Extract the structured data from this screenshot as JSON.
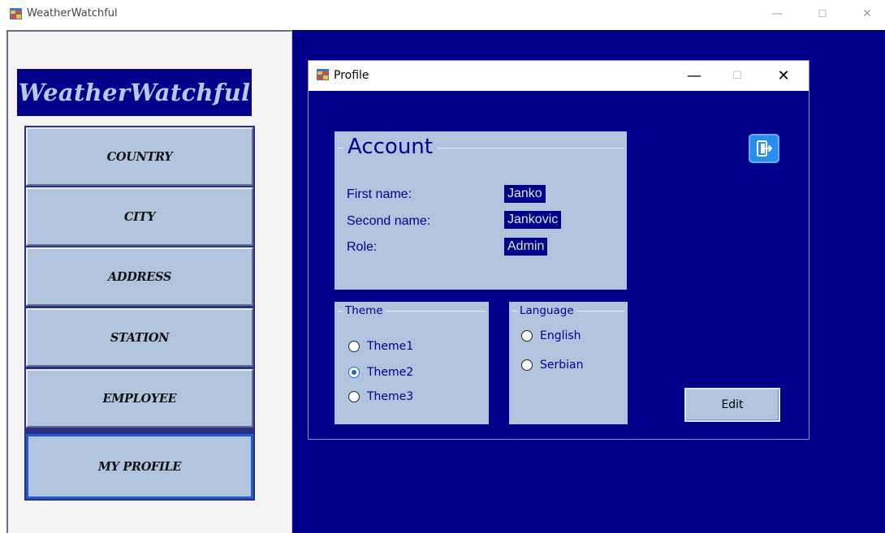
{
  "window": {
    "title": "WeatherWatchful",
    "minimize": "—",
    "maximize": "☐",
    "close": "✕"
  },
  "sidebar": {
    "logo": "WeatherWatchful",
    "items": [
      {
        "label": "COUNTRY"
      },
      {
        "label": "CITY"
      },
      {
        "label": "ADDRESS"
      },
      {
        "label": "STATION"
      },
      {
        "label": "EMPLOYEE"
      },
      {
        "label": "MY PROFILE",
        "active": true
      }
    ]
  },
  "profile": {
    "title": "Profile",
    "minimize": "—",
    "maximize": "☐",
    "close": "✕",
    "account": {
      "title": "Account",
      "first_name_label": "First name:",
      "first_name_value": "Janko",
      "second_name_label": "Second name:",
      "second_name_value": "Jankovic",
      "role_label": "Role:",
      "role_value": "Admin"
    },
    "theme": {
      "title": "Theme",
      "options": [
        {
          "label": "Theme1",
          "selected": false
        },
        {
          "label": "Theme2",
          "selected": true
        },
        {
          "label": "Theme3",
          "selected": false
        }
      ]
    },
    "language": {
      "title": "Language",
      "options": [
        {
          "label": "English",
          "selected": false
        },
        {
          "label": "Serbian",
          "selected": false
        }
      ]
    },
    "edit_label": "Edit",
    "logout_icon": "logout-icon"
  },
  "colors": {
    "background": "#00008b",
    "panel": "#b0c4de",
    "accent": "#2b8cf0"
  }
}
